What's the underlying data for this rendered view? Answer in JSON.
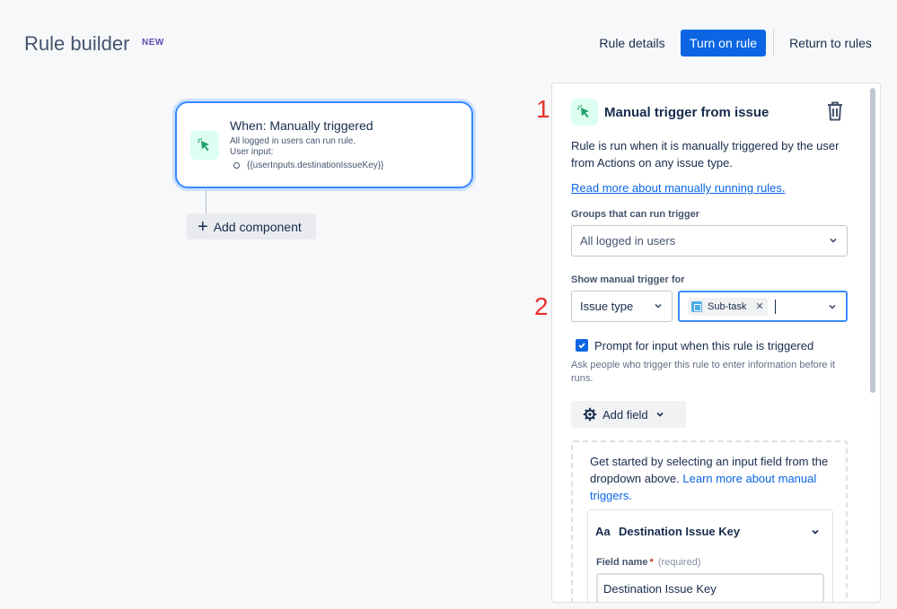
{
  "header": {
    "title": "Rule builder",
    "badge": "NEW",
    "rule_details_label": "Rule details",
    "turn_on_label": "Turn on rule",
    "return_label": "Return to rules"
  },
  "canvas": {
    "trigger": {
      "icon": "cursor-click-icon",
      "title": "When: Manually triggered",
      "line1": "All logged in users can run rule.",
      "line2": "User input:",
      "bullet": "{{userInputs.destinationIssueKey}}"
    },
    "add_component_label": "Add component"
  },
  "annotations": [
    "1",
    "2"
  ],
  "panel": {
    "icon": "cursor-click-icon",
    "title": "Manual trigger from issue",
    "description": "Rule is run when it is manually triggered by the user from Actions on any issue type.",
    "link": "Read more about manually running rules.",
    "groups_label": "Groups that can run trigger",
    "groups_value": "All logged in users",
    "show_label": "Show manual trigger for",
    "type_value": "Issue type",
    "tag_label": "Sub-task",
    "prompt_label": "Prompt for input when this rule is triggered",
    "prompt_checked": true,
    "prompt_help": "Ask people who trigger this rule to enter information before it runs.",
    "add_field_label": "Add field",
    "empty_text": "Get started by selecting an input field from the dropdown above.",
    "empty_link": "Learn more about manual triggers.",
    "field_card": {
      "type_glyph": "Aa",
      "title": "Destination Issue Key",
      "name_label": "Field name",
      "required_mark": "*",
      "required_hint": "(required)",
      "name_value": "Destination Issue Key"
    }
  },
  "colors": {
    "primary": "#0c66e4",
    "annotation": "#e5322d",
    "trigger_icon_bg": "#dcfff1",
    "trigger_icon": "#22a06b"
  }
}
